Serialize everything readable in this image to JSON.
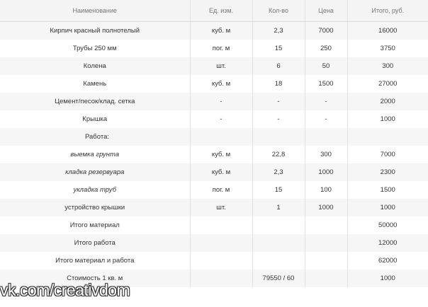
{
  "table": {
    "headers": [
      "Наименование",
      "Ед. изм.",
      "Кол-во",
      "Цена",
      "Итого, руб."
    ],
    "rows": [
      [
        "Кирпич красный полнотелый",
        "куб. м",
        "2,3",
        "7000",
        "16000"
      ],
      [
        "Трубы 250 мм",
        "пог. м",
        "15",
        "250",
        "3750"
      ],
      [
        "Колена",
        "шт.",
        "6",
        "50",
        "300"
      ],
      [
        "Камень",
        "куб. м",
        "18",
        "1500",
        "27000"
      ],
      [
        "Цемент/песок/клад. сетка",
        "-",
        "-",
        "-",
        "2000"
      ],
      [
        "Крышка",
        "-",
        "-",
        "-",
        "1000"
      ],
      [
        "Работа:",
        "",
        "",
        "",
        ""
      ],
      [
        "выемка грунта",
        "куб. м",
        "22,8",
        "300",
        "7000"
      ],
      [
        "кладка резервуара",
        "куб. м",
        "2,3",
        "1000",
        "2300"
      ],
      [
        "укладка труб",
        "пог. м",
        "15",
        "100",
        "1500"
      ],
      [
        "устройство крышки",
        "шт.",
        "1",
        "1000",
        "1000"
      ],
      [
        "Итого материал",
        "",
        "",
        "",
        "50000"
      ],
      [
        "Итого работа",
        "",
        "",
        "",
        "12000"
      ],
      [
        "Итого материал и работа",
        "",
        "",
        "",
        "62000"
      ],
      [
        "Стоимость 1 кв. м",
        "",
        "79550 / 60",
        "",
        "1000"
      ]
    ]
  },
  "watermark": "vk.com/creativdom"
}
